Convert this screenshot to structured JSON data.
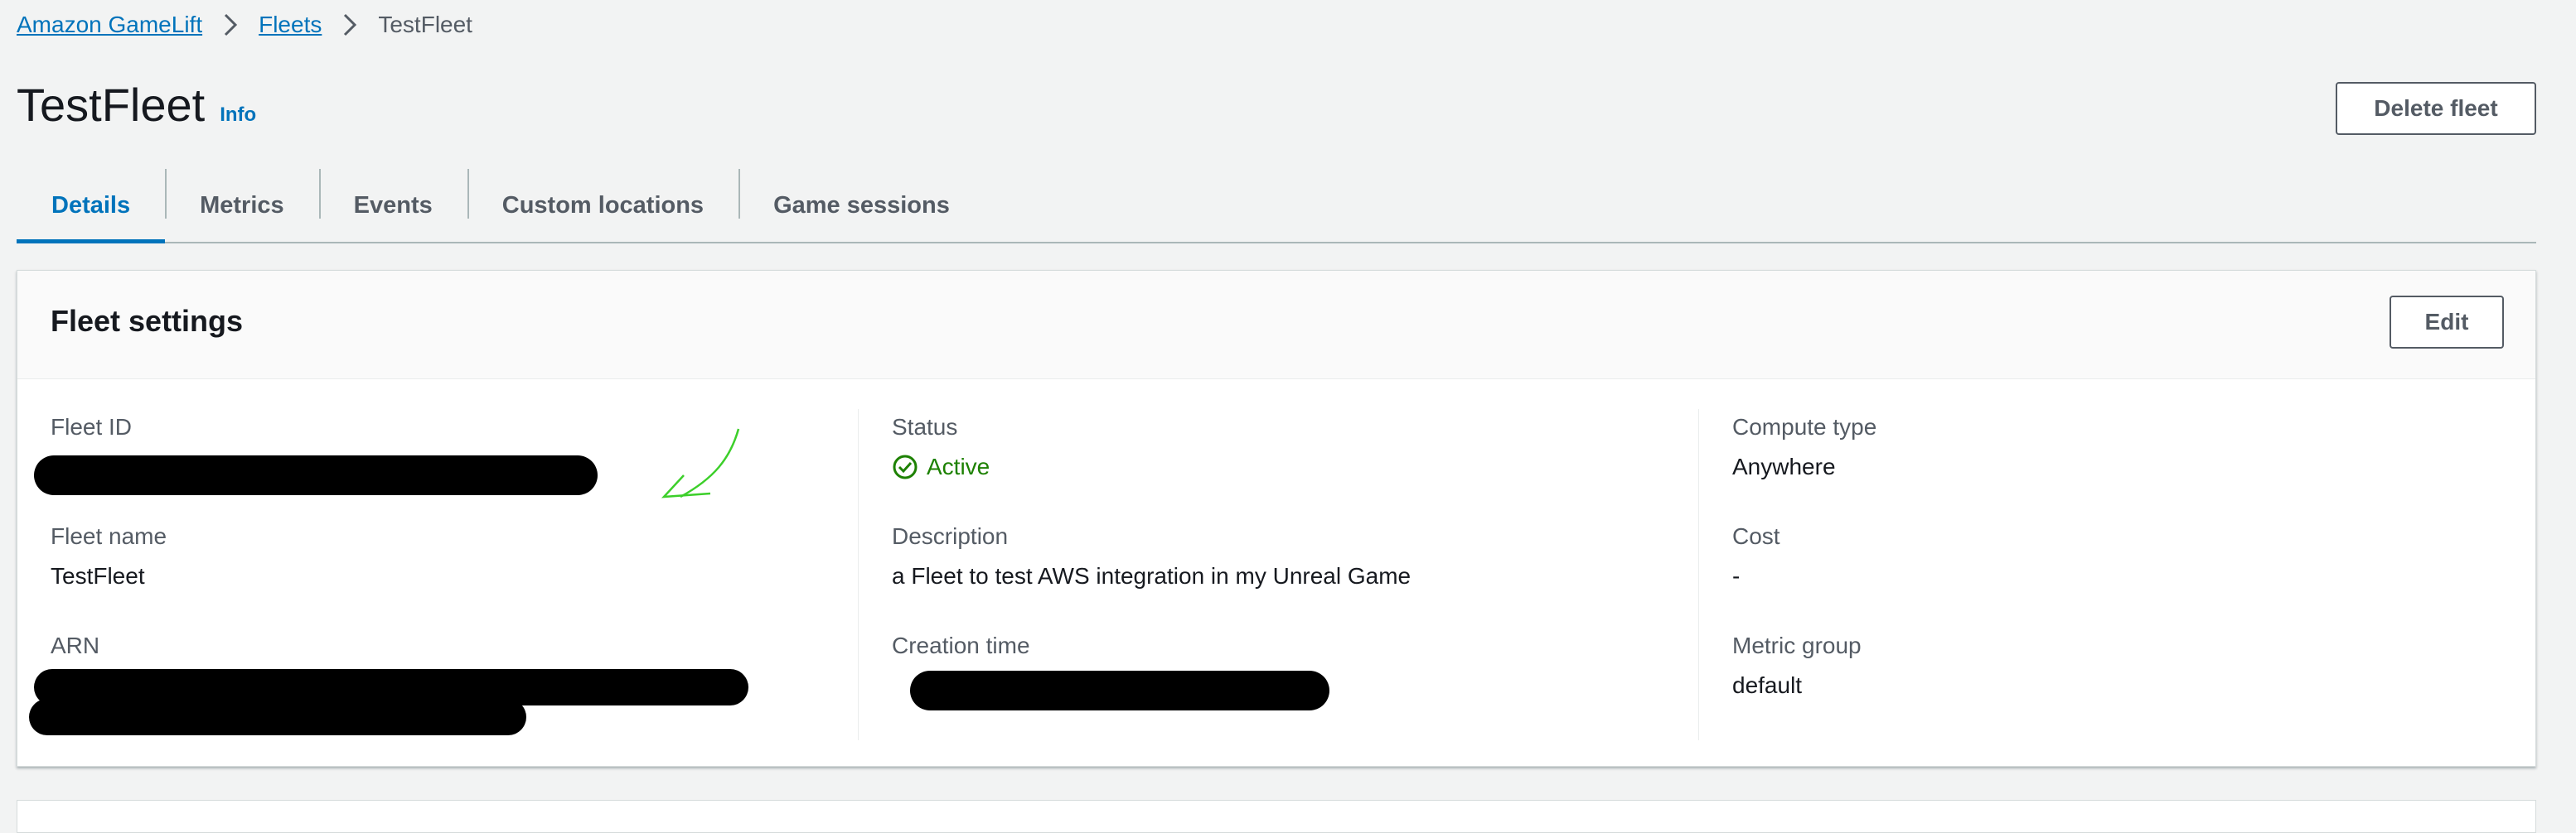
{
  "breadcrumb": {
    "items": [
      {
        "label": "Amazon GameLift"
      },
      {
        "label": "Fleets"
      },
      {
        "label": "TestFleet"
      }
    ]
  },
  "header": {
    "title": "TestFleet",
    "info_label": "Info",
    "delete_label": "Delete fleet"
  },
  "tabs": [
    {
      "label": "Details",
      "active": true
    },
    {
      "label": "Metrics"
    },
    {
      "label": "Events"
    },
    {
      "label": "Custom locations"
    },
    {
      "label": "Game sessions"
    }
  ],
  "fleet_settings": {
    "title": "Fleet settings",
    "edit_label": "Edit",
    "fleet_id": {
      "label": "Fleet ID"
    },
    "fleet_name": {
      "label": "Fleet name",
      "value": "TestFleet"
    },
    "arn": {
      "label": "ARN"
    },
    "status": {
      "label": "Status",
      "value": "Active"
    },
    "description": {
      "label": "Description",
      "value": "a Fleet to test AWS integration in my Unreal Game"
    },
    "creation_time": {
      "label": "Creation time"
    },
    "compute_type": {
      "label": "Compute type",
      "value": "Anywhere"
    },
    "cost": {
      "label": "Cost",
      "value": "-"
    },
    "metric_group": {
      "label": "Metric group",
      "value": "default"
    }
  },
  "colors": {
    "link": "#0073bb",
    "status_active": "#1d8102",
    "annotation_arrow": "#3ccf2a"
  },
  "icons": [
    "chevron-right-icon",
    "check-circle-icon",
    "annotation-arrow-icon"
  ]
}
